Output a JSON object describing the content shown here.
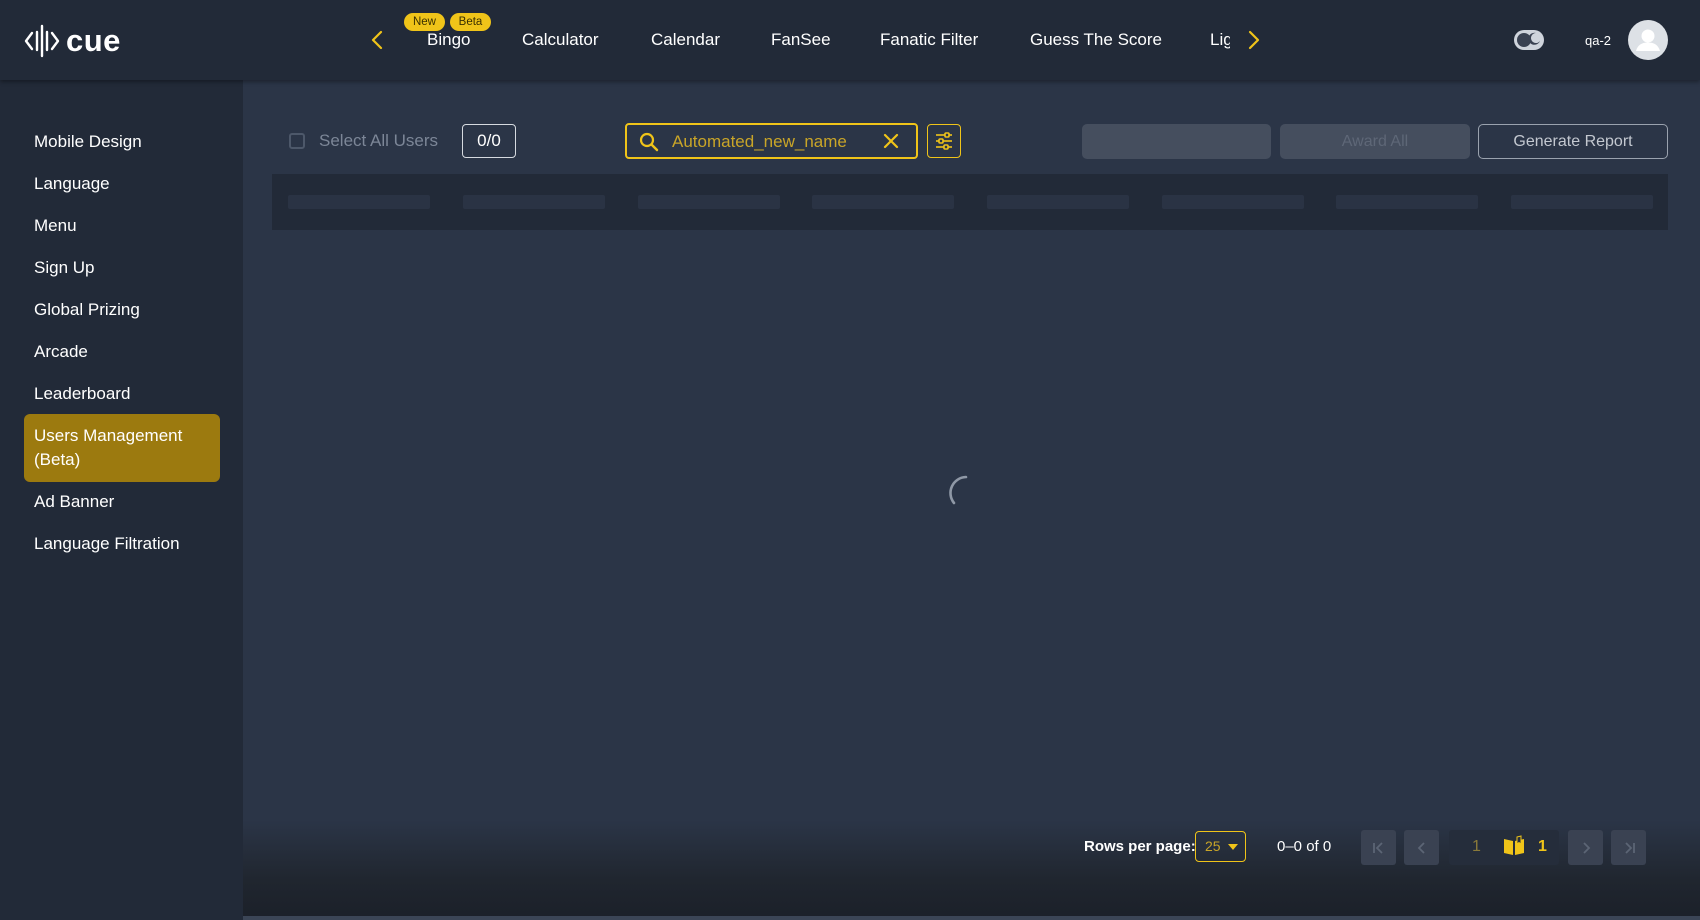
{
  "app": {
    "logo_text": "cue"
  },
  "topnav": {
    "tabs": [
      {
        "label": "Bingo",
        "badges": [
          "New",
          "Beta"
        ]
      },
      {
        "label": "Calculator"
      },
      {
        "label": "Calendar"
      },
      {
        "label": "FanSee"
      },
      {
        "label": "Fanatic Filter"
      },
      {
        "label": "Guess The Score"
      },
      {
        "label": "Lig"
      }
    ],
    "username": "qa-2",
    "accent_color": "#f0c419"
  },
  "sidebar": {
    "items": [
      {
        "label": "Mobile Design"
      },
      {
        "label": "Language"
      },
      {
        "label": "Menu"
      },
      {
        "label": "Sign Up"
      },
      {
        "label": "Global Prizing"
      },
      {
        "label": "Arcade"
      },
      {
        "label": "Leaderboard"
      },
      {
        "label": "Users Management (Beta)",
        "active": true
      },
      {
        "label": "Ad Banner"
      },
      {
        "label": "Language Filtration"
      }
    ],
    "active_color": "#9c7a0f"
  },
  "toolbar": {
    "select_all_label": "Select All Users",
    "selected_count": "0/0",
    "search_value": "Automated_new_name",
    "award_all_label": "Award All",
    "generate_report_label": "Generate Report"
  },
  "pagination": {
    "rows_per_page_label": "Rows per page:",
    "rows_per_page_value": "25",
    "range_text": "0–0 of 0",
    "current_page": "1",
    "total_pages": "1"
  }
}
